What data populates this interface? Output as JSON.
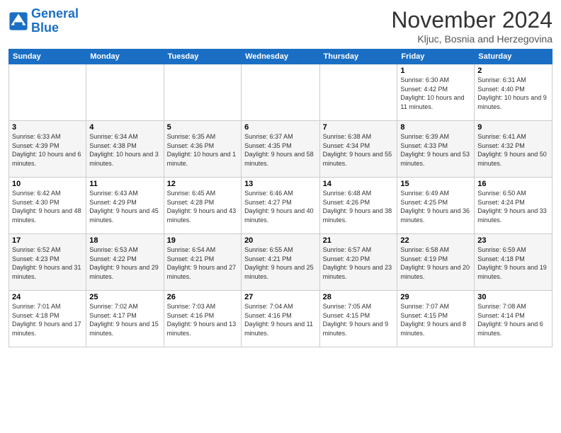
{
  "header": {
    "logo_line1": "General",
    "logo_line2": "Blue",
    "month_title": "November 2024",
    "location": "Kljuc, Bosnia and Herzegovina"
  },
  "weekdays": [
    "Sunday",
    "Monday",
    "Tuesday",
    "Wednesday",
    "Thursday",
    "Friday",
    "Saturday"
  ],
  "rows": [
    [
      {
        "day": "",
        "info": ""
      },
      {
        "day": "",
        "info": ""
      },
      {
        "day": "",
        "info": ""
      },
      {
        "day": "",
        "info": ""
      },
      {
        "day": "",
        "info": ""
      },
      {
        "day": "1",
        "info": "Sunrise: 6:30 AM\nSunset: 4:42 PM\nDaylight: 10 hours and 11 minutes."
      },
      {
        "day": "2",
        "info": "Sunrise: 6:31 AM\nSunset: 4:40 PM\nDaylight: 10 hours and 9 minutes."
      }
    ],
    [
      {
        "day": "3",
        "info": "Sunrise: 6:33 AM\nSunset: 4:39 PM\nDaylight: 10 hours and 6 minutes."
      },
      {
        "day": "4",
        "info": "Sunrise: 6:34 AM\nSunset: 4:38 PM\nDaylight: 10 hours and 3 minutes."
      },
      {
        "day": "5",
        "info": "Sunrise: 6:35 AM\nSunset: 4:36 PM\nDaylight: 10 hours and 1 minute."
      },
      {
        "day": "6",
        "info": "Sunrise: 6:37 AM\nSunset: 4:35 PM\nDaylight: 9 hours and 58 minutes."
      },
      {
        "day": "7",
        "info": "Sunrise: 6:38 AM\nSunset: 4:34 PM\nDaylight: 9 hours and 55 minutes."
      },
      {
        "day": "8",
        "info": "Sunrise: 6:39 AM\nSunset: 4:33 PM\nDaylight: 9 hours and 53 minutes."
      },
      {
        "day": "9",
        "info": "Sunrise: 6:41 AM\nSunset: 4:32 PM\nDaylight: 9 hours and 50 minutes."
      }
    ],
    [
      {
        "day": "10",
        "info": "Sunrise: 6:42 AM\nSunset: 4:30 PM\nDaylight: 9 hours and 48 minutes."
      },
      {
        "day": "11",
        "info": "Sunrise: 6:43 AM\nSunset: 4:29 PM\nDaylight: 9 hours and 45 minutes."
      },
      {
        "day": "12",
        "info": "Sunrise: 6:45 AM\nSunset: 4:28 PM\nDaylight: 9 hours and 43 minutes."
      },
      {
        "day": "13",
        "info": "Sunrise: 6:46 AM\nSunset: 4:27 PM\nDaylight: 9 hours and 40 minutes."
      },
      {
        "day": "14",
        "info": "Sunrise: 6:48 AM\nSunset: 4:26 PM\nDaylight: 9 hours and 38 minutes."
      },
      {
        "day": "15",
        "info": "Sunrise: 6:49 AM\nSunset: 4:25 PM\nDaylight: 9 hours and 36 minutes."
      },
      {
        "day": "16",
        "info": "Sunrise: 6:50 AM\nSunset: 4:24 PM\nDaylight: 9 hours and 33 minutes."
      }
    ],
    [
      {
        "day": "17",
        "info": "Sunrise: 6:52 AM\nSunset: 4:23 PM\nDaylight: 9 hours and 31 minutes."
      },
      {
        "day": "18",
        "info": "Sunrise: 6:53 AM\nSunset: 4:22 PM\nDaylight: 9 hours and 29 minutes."
      },
      {
        "day": "19",
        "info": "Sunrise: 6:54 AM\nSunset: 4:21 PM\nDaylight: 9 hours and 27 minutes."
      },
      {
        "day": "20",
        "info": "Sunrise: 6:55 AM\nSunset: 4:21 PM\nDaylight: 9 hours and 25 minutes."
      },
      {
        "day": "21",
        "info": "Sunrise: 6:57 AM\nSunset: 4:20 PM\nDaylight: 9 hours and 23 minutes."
      },
      {
        "day": "22",
        "info": "Sunrise: 6:58 AM\nSunset: 4:19 PM\nDaylight: 9 hours and 20 minutes."
      },
      {
        "day": "23",
        "info": "Sunrise: 6:59 AM\nSunset: 4:18 PM\nDaylight: 9 hours and 19 minutes."
      }
    ],
    [
      {
        "day": "24",
        "info": "Sunrise: 7:01 AM\nSunset: 4:18 PM\nDaylight: 9 hours and 17 minutes."
      },
      {
        "day": "25",
        "info": "Sunrise: 7:02 AM\nSunset: 4:17 PM\nDaylight: 9 hours and 15 minutes."
      },
      {
        "day": "26",
        "info": "Sunrise: 7:03 AM\nSunset: 4:16 PM\nDaylight: 9 hours and 13 minutes."
      },
      {
        "day": "27",
        "info": "Sunrise: 7:04 AM\nSunset: 4:16 PM\nDaylight: 9 hours and 11 minutes."
      },
      {
        "day": "28",
        "info": "Sunrise: 7:05 AM\nSunset: 4:15 PM\nDaylight: 9 hours and 9 minutes."
      },
      {
        "day": "29",
        "info": "Sunrise: 7:07 AM\nSunset: 4:15 PM\nDaylight: 9 hours and 8 minutes."
      },
      {
        "day": "30",
        "info": "Sunrise: 7:08 AM\nSunset: 4:14 PM\nDaylight: 9 hours and 6 minutes."
      }
    ]
  ]
}
